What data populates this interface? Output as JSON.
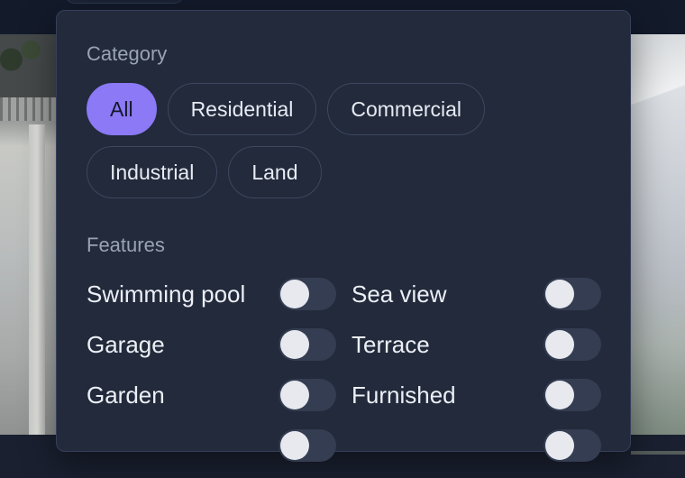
{
  "filters": {
    "category_title": "Category",
    "categories": [
      {
        "label": "All",
        "active": true
      },
      {
        "label": "Residential",
        "active": false
      },
      {
        "label": "Commercial",
        "active": false
      },
      {
        "label": "Industrial",
        "active": false
      },
      {
        "label": "Land",
        "active": false
      }
    ],
    "features_title": "Features",
    "features": [
      {
        "label": "Swimming pool",
        "enabled": false
      },
      {
        "label": "Sea view",
        "enabled": false
      },
      {
        "label": "Garage",
        "enabled": false
      },
      {
        "label": "Terrace",
        "enabled": false
      },
      {
        "label": "Garden",
        "enabled": false
      },
      {
        "label": "Furnished",
        "enabled": false
      }
    ]
  },
  "colors": {
    "accent": "#8b79f5",
    "panel_bg": "#222a3b",
    "toggle_off": "#343d51"
  }
}
